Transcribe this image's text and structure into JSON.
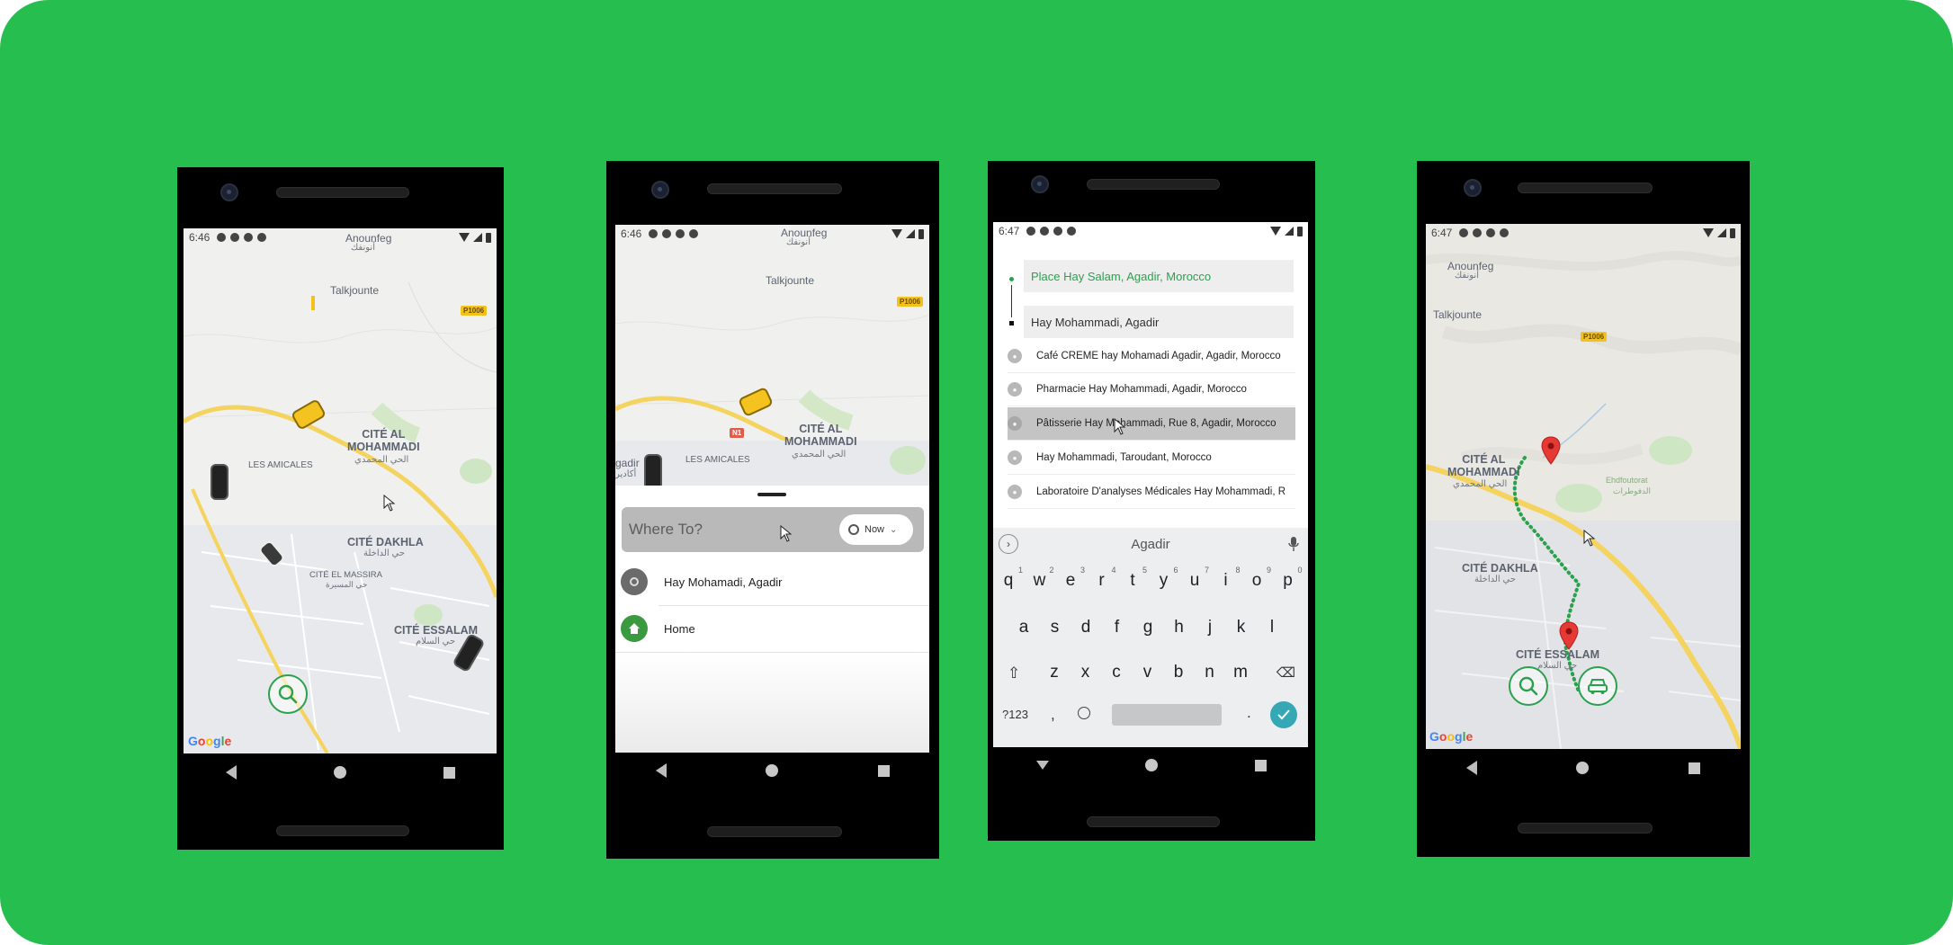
{
  "background_color": "#27be50",
  "phone1": {
    "status_time": "6:46",
    "map_labels": {
      "anounfeg": "Anounfeg",
      "anounfeg_ar": "أنونفك",
      "talkjounte": "Talkjounte",
      "road": "P1006",
      "cite_al_mohammadi": "CITÉ AL\nMOHAMMADI",
      "cite_al_mohammadi_ar": "الحي المحمدي",
      "les_amicales": "LES AMICALES",
      "cite_dakhla": "CITÉ DAKHLA",
      "cite_dakhla_ar": "حي الداخلة",
      "cite_el_massira": "CITÉ EL MASSIRA",
      "cite_el_massira_ar": "حي المسيرة",
      "cite_essalam": "CITÉ ESSALAM",
      "cite_essalam_ar": "حي السلام"
    },
    "google": "Google",
    "search_icon": "search-icon"
  },
  "phone2": {
    "status_time": "6:46",
    "map_labels": {
      "anounfeg": "Anounfeg",
      "anounfeg_ar": "أنونفك",
      "talkjounte": "Talkjounte",
      "road": "P1006",
      "road2": "N1",
      "cite_al_mohammadi": "CITÉ AL\nMOHAMMADI",
      "cite_al_mohammadi_ar": "الحي المحمدي",
      "les_amicales": "LES AMICALES",
      "agadir": "gadir",
      "agadir_ar": "أكادير"
    },
    "where_to_placeholder": "Where To?",
    "now_label": "Now",
    "rows": [
      {
        "label": "Hay Mohamadi, Agadir",
        "icon": "clock-icon",
        "color": "#6b6b6b"
      },
      {
        "label": "Home",
        "icon": "home-icon",
        "color": "#3b9a3f"
      }
    ]
  },
  "phone3": {
    "status_time": "6:47",
    "pickup": "Place Hay Salam, Agadir, Morocco",
    "destination": "Hay Mohammadi, Agadir",
    "suggestions": [
      "Café CREME hay Mohamadi Agadir, Agadir, Morocco",
      "Pharmacie Hay Mohammadi, Agadir, Morocco",
      "Pâtisserie Hay Mohammadi, Rue 8, Agadir, Morocco",
      "Hay Mohammadi, Taroudant, Morocco",
      "Laboratoire D'analyses Médicales Hay Mohammadi, R"
    ],
    "selected_index": 2,
    "keyboard": {
      "suggestion": "Agadir",
      "row1": [
        "q",
        "w",
        "e",
        "r",
        "t",
        "y",
        "u",
        "i",
        "o",
        "p"
      ],
      "row1_nums": [
        "1",
        "2",
        "3",
        "4",
        "5",
        "6",
        "7",
        "8",
        "9",
        "0"
      ],
      "row2": [
        "a",
        "s",
        "d",
        "f",
        "g",
        "h",
        "j",
        "k",
        "l"
      ],
      "row3": [
        "z",
        "x",
        "c",
        "v",
        "b",
        "n",
        "m"
      ],
      "mode_key": "?123",
      "comma": ",",
      "period": "."
    },
    "accent": "#2aa14d"
  },
  "phone4": {
    "status_time": "6:47",
    "map_labels": {
      "anounfeg": "Anounfeg",
      "anounfeg_ar": "أنونفك",
      "talkjounte": "Talkjounte",
      "road": "P1006",
      "cite_al_mohammadi": "CITÉ AL\nMOHAMMADI",
      "cite_al_mohammadi_ar": "الحي المحمدي",
      "cite_dakhla": "CITÉ DAKHLA",
      "cite_dakhla_ar": "حي الداخلة",
      "cite_essalam": "CITÉ ESSALAM",
      "cite_essalam_ar": "حي السلام",
      "park": "Ehdfoutorat",
      "park_ar": "الدفوطرات"
    },
    "google": "Google",
    "route_color": "#2aa14d",
    "pin_color": "#e53935"
  }
}
